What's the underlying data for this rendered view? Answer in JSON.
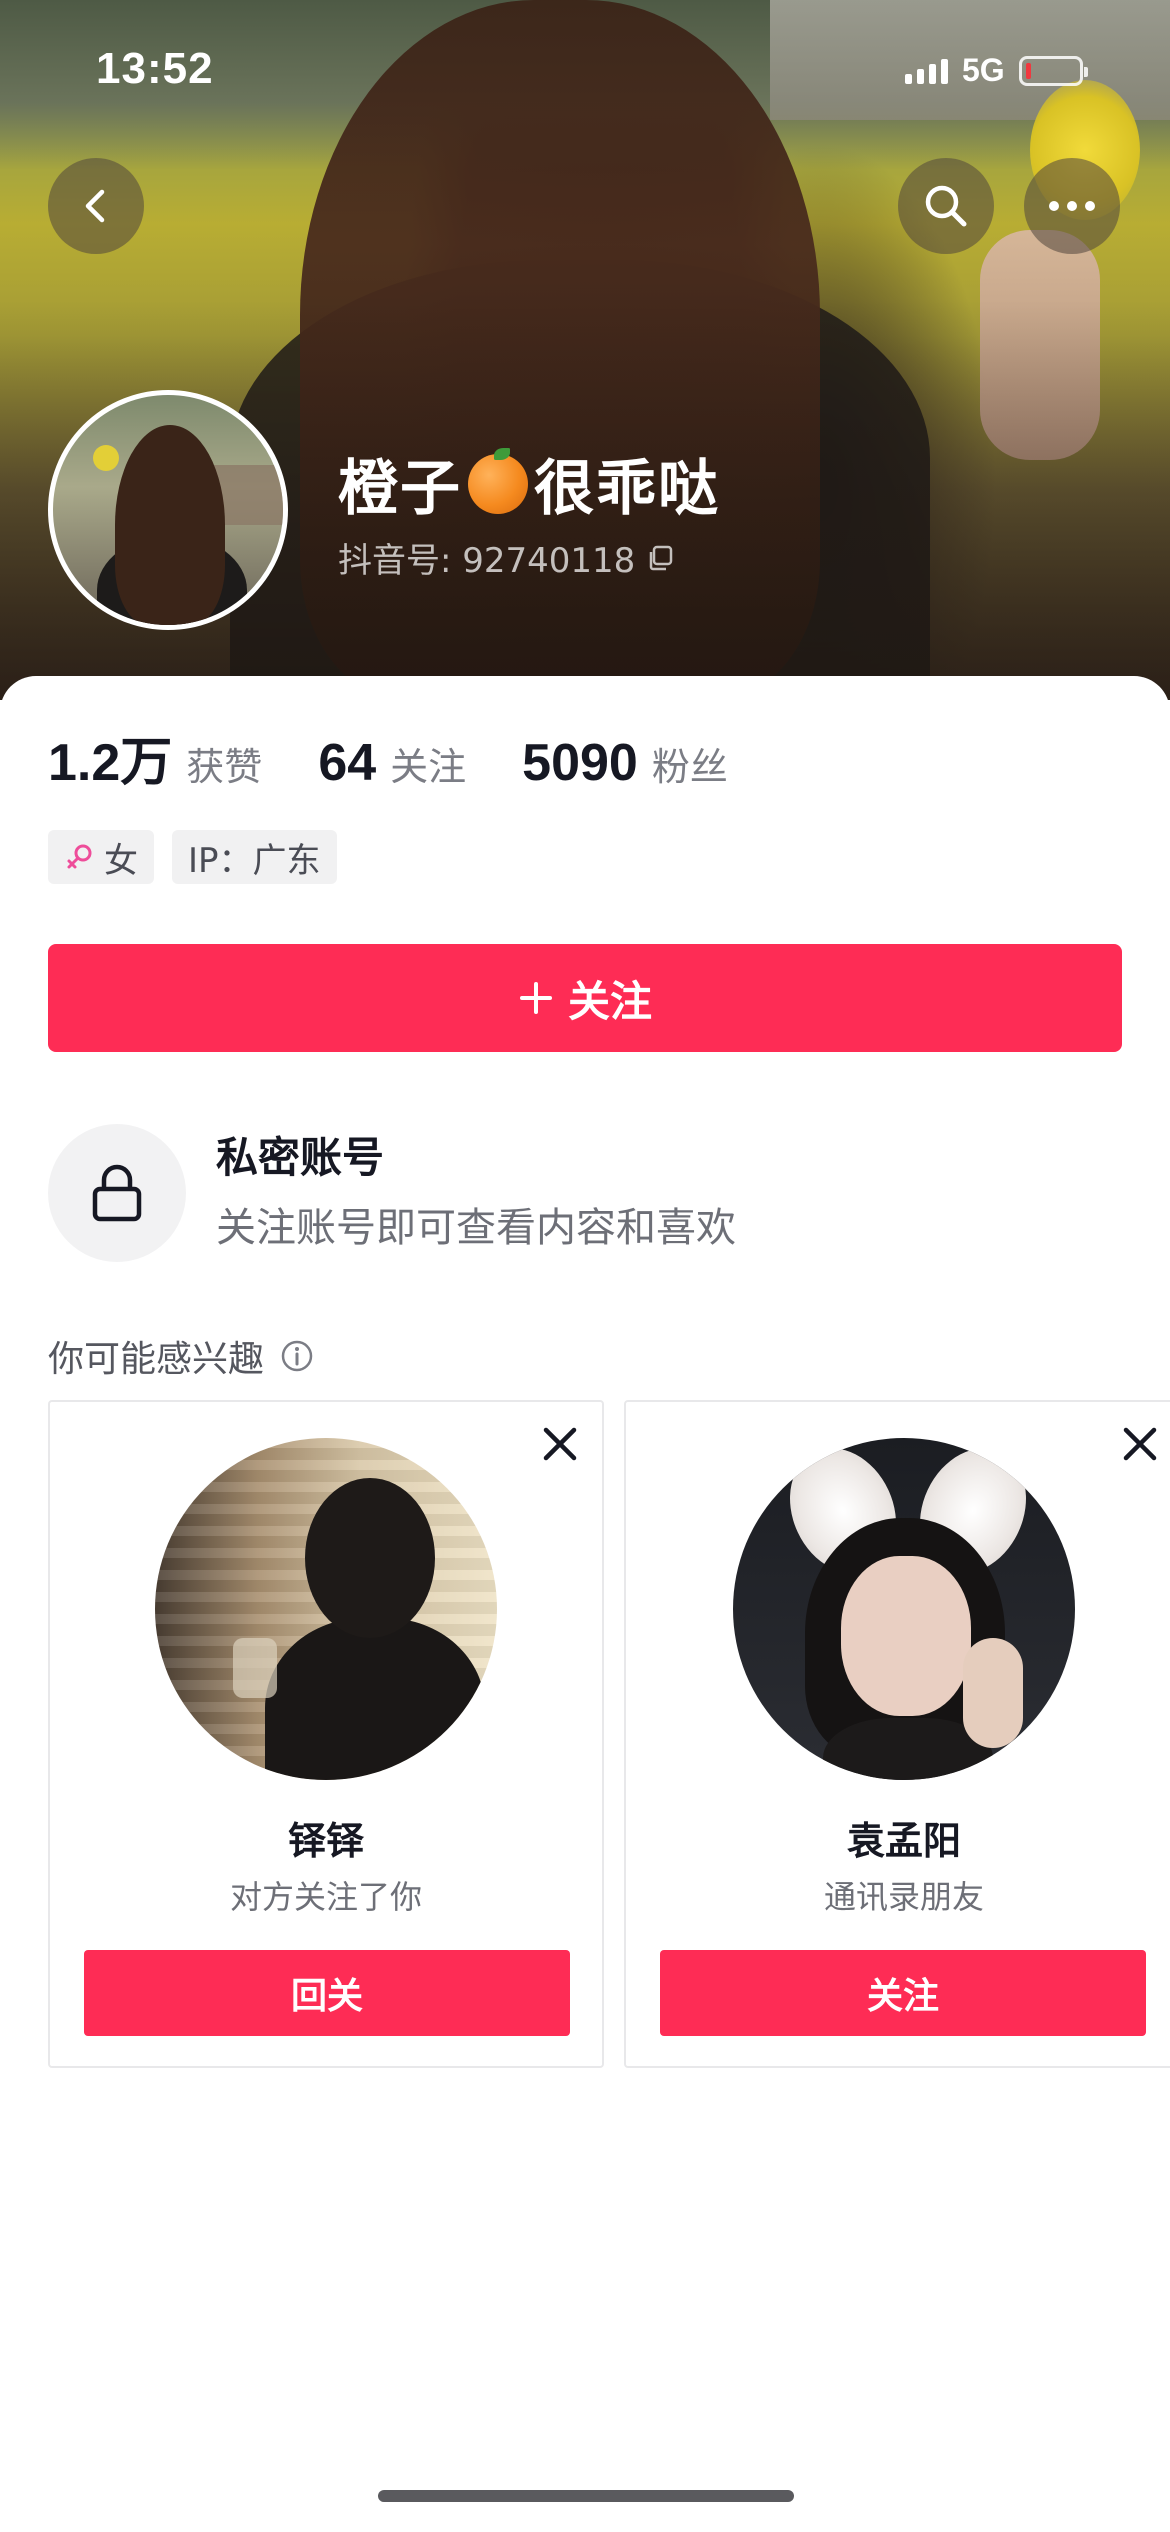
{
  "status_bar": {
    "time": "13:52",
    "network": "5G",
    "battery_level": 0.08
  },
  "header": {
    "back_icon": "chevron-left-icon",
    "search_icon": "search-icon",
    "more_icon": "more-horizontal-icon"
  },
  "profile": {
    "name_prefix": "橙子",
    "name_emoji_icon": "orange-emoji-icon",
    "name_suffix": "很乖哒",
    "id_label": "抖音号: 92740118",
    "copy_icon": "copy-icon"
  },
  "stats": [
    {
      "value": "1.2万",
      "label": "获赞"
    },
    {
      "value": "64",
      "label": "关注"
    },
    {
      "value": "5090",
      "label": "粉丝"
    }
  ],
  "tags": {
    "gender": "女",
    "gender_icon": "female-icon",
    "gender_color": "#ee4d9a",
    "ip": "IP：广东"
  },
  "follow_button": {
    "label": "关注",
    "icon": "plus-icon",
    "color": "#fe2c55"
  },
  "private_account": {
    "icon": "lock-icon",
    "title": "私密账号",
    "description": "关注账号即可查看内容和喜欢"
  },
  "suggestions": {
    "title": "你可能感兴趣",
    "info_icon": "info-icon",
    "cards": [
      {
        "name": "铎铎",
        "subtitle": "对方关注了你",
        "button": "回关"
      },
      {
        "name": "袁孟阳",
        "subtitle": "通讯录朋友",
        "button": "关注"
      }
    ]
  }
}
